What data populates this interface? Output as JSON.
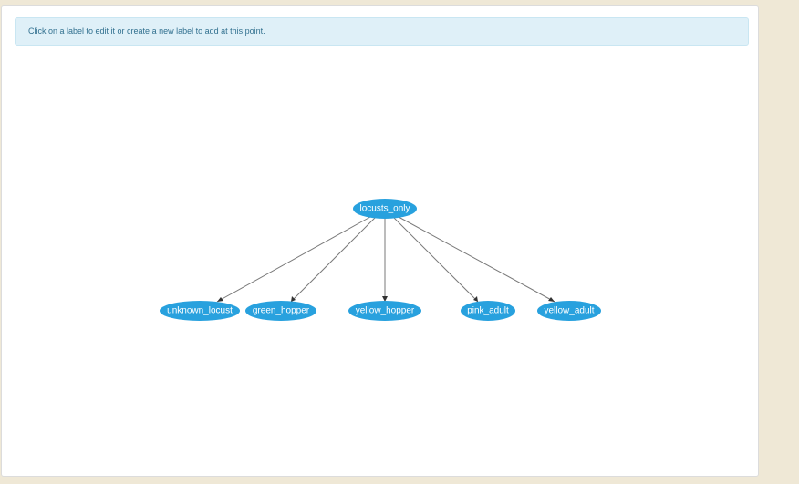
{
  "info": {
    "message": "Click on a label to edit it or create a new label to add at this point."
  },
  "graph": {
    "root": "locusts_only",
    "children": [
      "unknown_locust",
      "green_hopper",
      "yellow_hopper",
      "pink_adult",
      "yellow_adult"
    ],
    "node_color": "#28a1de"
  }
}
